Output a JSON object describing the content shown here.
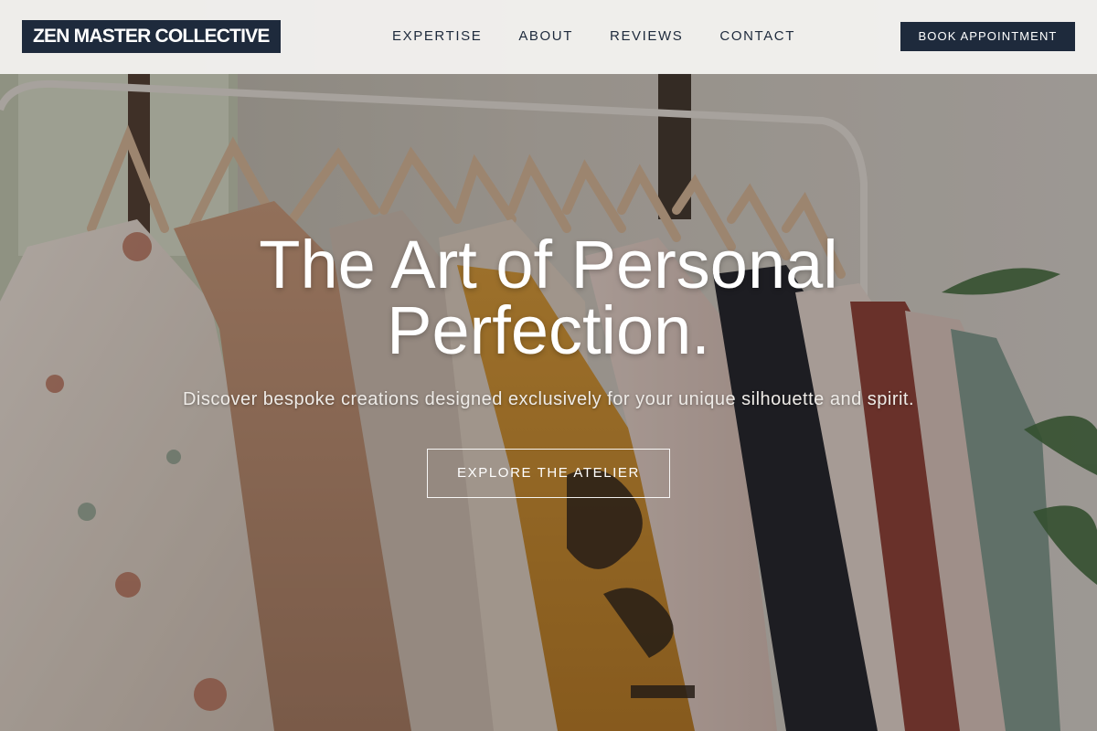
{
  "brand": {
    "name": "ZEN MASTER COLLECTIVE"
  },
  "nav": {
    "items": [
      {
        "label": "EXPERTISE"
      },
      {
        "label": "ABOUT"
      },
      {
        "label": "REVIEWS"
      },
      {
        "label": "CONTACT"
      }
    ]
  },
  "header": {
    "cta_label": "BOOK APPOINTMENT"
  },
  "hero": {
    "title_line1": "The Art of Personal",
    "title_line2": "Perfection.",
    "subtitle": "Discover bespoke creations designed exclusively for your unique silhouette and spirit.",
    "cta_label": "EXPLORE THE ATELIER",
    "background_image": "clothing-rack-photo"
  },
  "colors": {
    "navy": "#1e2a3c",
    "header_bg": "#f4f3f1",
    "white": "#ffffff"
  }
}
